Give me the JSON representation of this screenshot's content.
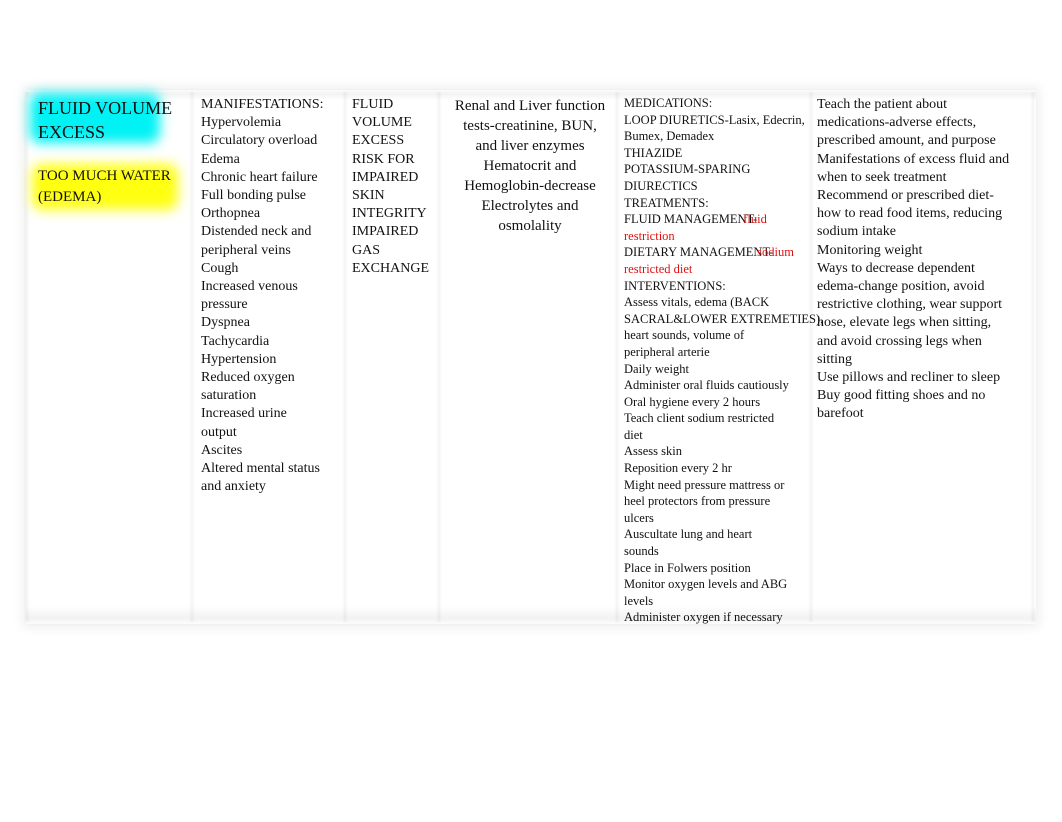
{
  "columns": {
    "diagnosis": {
      "title_lines": [
        "FLUID VOLUME",
        "EXCESS"
      ],
      "subtitle_lines": [
        "TOO MUCH WATER",
        "(EDEMA)"
      ],
      "highlight_colors": {
        "title": "#00f2f5",
        "subtitle": "#ffff10"
      }
    },
    "manifestations": {
      "heading": "MANIFESTATIONS:",
      "lines": [
        "Hypervolemia",
        "Circulatory overload",
        "Edema",
        "Chronic heart failure",
        "Full bonding pulse",
        "Orthopnea",
        "Distended neck and",
        "peripheral veins",
        "Cough",
        "Increased venous",
        "pressure",
        "Dyspnea",
        "Tachycardia",
        "Hypertension",
        "Reduced oxygen",
        "saturation",
        "Increased urine",
        "output",
        "Ascites",
        "Altered mental status",
        "and anxiety"
      ]
    },
    "nursing_diagnoses": {
      "lines": [
        "FLUID",
        "VOLUME",
        "EXCESS",
        "RISK FOR",
        "IMPAIRED",
        "SKIN",
        "INTEGRITY",
        "IMPAIRED",
        "GAS",
        "EXCHANGE"
      ]
    },
    "labs": {
      "lines": [
        "Renal and Liver function",
        "tests-creatinine, BUN,",
        "and liver enzymes",
        "Hematocrit and",
        "Hemoglobin-decrease",
        "Electrolytes and",
        "osmolality"
      ]
    },
    "treatment": {
      "medications_heading": "MEDICATIONS:",
      "medication_lines": [
        "LOOP DIURETICS-Lasix, Edecrin,",
        "Bumex, Demadex",
        "THIAZIDE",
        "POTASSIUM-SPARING",
        "DIURECTICS"
      ],
      "treatments_heading": "TREATMENTS:",
      "fluid_management_label": "FLUID MANAGEMENT-",
      "fluid_management_value": "fluid",
      "fluid_management_value_cont": "restriction",
      "dietary_management_label": "DIETARY MANAGEMENT-",
      "dietary_management_value": "sodium",
      "dietary_management_value_cont": "restricted diet",
      "accent_color": "#e01010",
      "interventions_heading": "INTERVENTIONS:",
      "intervention_lines": [
        "Assess vitals, edema (BACK",
        "SACRAL&LOWER EXTREMETIES),",
        "heart sounds, volume of",
        "peripheral arterie",
        "Daily weight",
        "Administer oral fluids cautiously",
        "Oral hygiene every 2 hours",
        "Teach client sodium restricted",
        "diet",
        "Assess skin",
        "Reposition every 2 hr",
        "Might need pressure mattress or",
        "heel protectors from pressure",
        "ulcers",
        "Auscultate lung and heart",
        "sounds",
        "Place in Folwers position",
        "Monitor oxygen levels and ABG",
        "levels",
        "Administer oxygen if necessary"
      ]
    },
    "teaching": {
      "lines": [
        "Teach the patient about",
        "medications-adverse effects,",
        "prescribed amount, and purpose",
        "Manifestations of excess fluid and",
        "when to seek treatment",
        "Recommend or prescribed diet-",
        "how to read food items, reducing",
        "sodium intake",
        "Monitoring weight",
        "Ways to decrease dependent",
        "edema-change position, avoid",
        "restrictive clothing, wear support",
        "hose, elevate legs when sitting,",
        "and avoid crossing legs when",
        "sitting",
        "Use pillows and recliner to sleep",
        "Buy good fitting shoes and no",
        "barefoot"
      ]
    }
  }
}
